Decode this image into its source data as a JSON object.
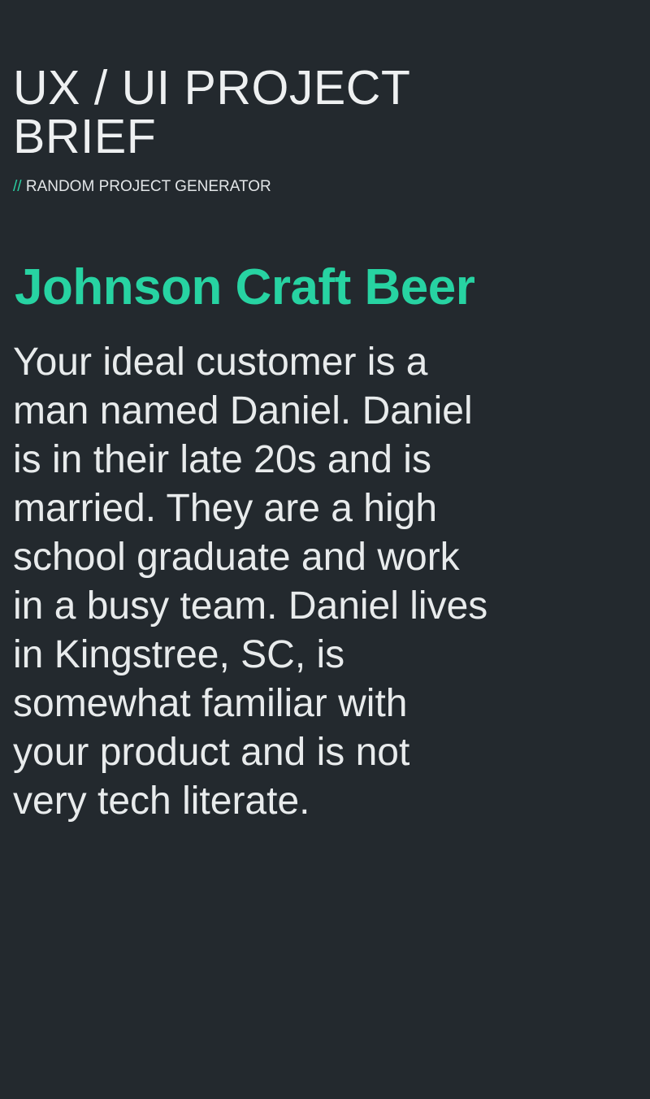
{
  "header": {
    "title": "UX / UI PROJECT BRIEF",
    "subtitle_prefix": "//",
    "subtitle": "RANDOM PROJECT GENERATOR"
  },
  "project": {
    "name": "Johnson Craft Beer",
    "brief": "Your ideal customer is a man named Daniel. Daniel is in their late 20s and is married. They are a high school graduate and work in a busy team. Daniel lives in Kingstree, SC, is somewhat familiar with your product and is not very tech literate."
  },
  "colors": {
    "background": "#23292e",
    "accent": "#27d3a2",
    "text": "#e8ebec"
  }
}
